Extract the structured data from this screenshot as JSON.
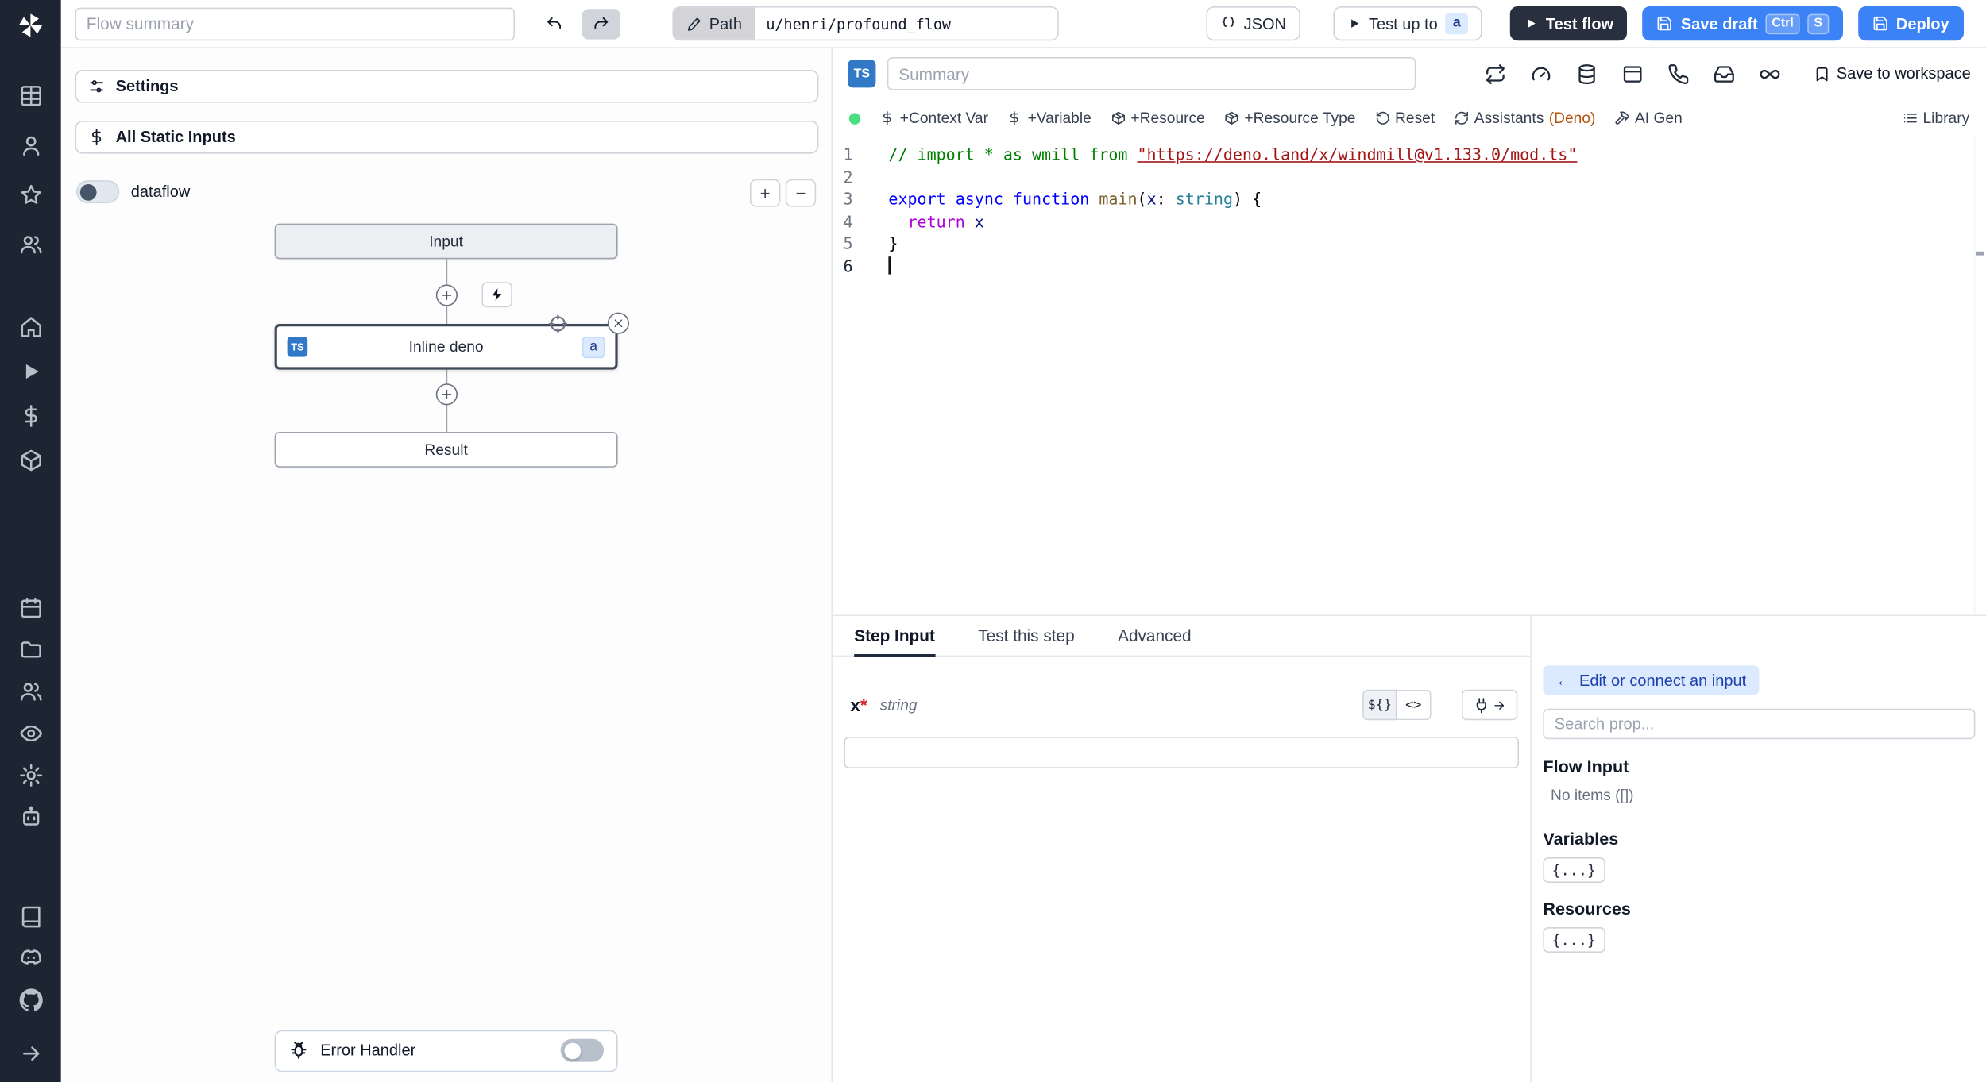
{
  "topbar": {
    "flow_summary_placeholder": "Flow summary",
    "path_label": "Path",
    "path_value": "u/henri/profound_flow",
    "json_label": "JSON",
    "test_up_to_label": "Test up to",
    "test_up_to_badge": "a",
    "test_flow_label": "Test flow",
    "save_draft_label": "Save draft",
    "kbd_ctrl": "Ctrl",
    "kbd_s": "S",
    "deploy_label": "Deploy"
  },
  "rail": {
    "groups": [
      [
        "table",
        "user",
        "star",
        "users"
      ],
      [
        "home",
        "play",
        "dollar",
        "cube"
      ],
      [
        "calendar",
        "folder",
        "users2",
        "eye",
        "settings",
        "bot"
      ],
      [
        "book",
        "discord",
        "github"
      ]
    ]
  },
  "flow": {
    "settings_label": "Settings",
    "static_inputs_label": "All Static Inputs",
    "dataflow_label": "dataflow",
    "zoom_in": "+",
    "zoom_out": "−",
    "nodes": {
      "input_label": "Input",
      "step_label": "Inline deno",
      "step_lang_badge": "TS",
      "step_id_badge": "a",
      "result_label": "Result"
    },
    "error_handler_label": "Error Handler"
  },
  "editor": {
    "lang_badge": "TS",
    "summary_placeholder": "Summary",
    "save_to_workspace_label": "Save to workspace",
    "trigger_icons": [
      "repeat",
      "gauge",
      "database",
      "window",
      "phone",
      "inbox",
      "infinity"
    ],
    "toolbar": {
      "context_var": "+Context Var",
      "variable": "+Variable",
      "resource": "+Resource",
      "resource_type": "+Resource Type",
      "reset": "Reset",
      "assistants": "Assistants",
      "assistants_lang": "(Deno)",
      "ai_gen": "AI Gen",
      "library": "Library"
    },
    "code": {
      "lines": [
        {
          "num": "1",
          "tokens": [
            [
              "// import * as wmill from ",
              "cmt"
            ],
            [
              "\"https://deno.land/x/windmill@v1.133.0/mod.ts\"",
              "lnk"
            ]
          ]
        },
        {
          "num": "2",
          "tokens": []
        },
        {
          "num": "3",
          "tokens": [
            [
              "export",
              "kw"
            ],
            [
              " ",
              ""
            ],
            [
              "async",
              "kw"
            ],
            [
              " ",
              ""
            ],
            [
              "function",
              "kw"
            ],
            [
              " ",
              ""
            ],
            [
              "main",
              "fn"
            ],
            [
              "(",
              ""
            ],
            [
              "x",
              "vr"
            ],
            [
              ": ",
              ""
            ],
            [
              "string",
              "ty"
            ],
            [
              ") {",
              ""
            ]
          ]
        },
        {
          "num": "4",
          "tokens": [
            [
              "  ",
              ""
            ],
            [
              "return",
              "kw2"
            ],
            [
              " ",
              ""
            ],
            [
              "x",
              "vr"
            ]
          ]
        },
        {
          "num": "5",
          "tokens": [
            [
              "}",
              ""
            ]
          ]
        },
        {
          "num": "6",
          "tokens": [],
          "cursor": true
        }
      ]
    }
  },
  "step_panel": {
    "tabs": [
      "Step Input",
      "Test this step",
      "Advanced"
    ],
    "arg_name": "x",
    "arg_required": "*",
    "arg_type": "string",
    "template_button": "${}",
    "code_button": "<>",
    "sidebar": {
      "connect_arrow": "←",
      "connect_label": "Edit or connect an input",
      "search_placeholder": "Search prop...",
      "flow_input_title": "Flow Input",
      "no_items": "No items ([])",
      "variables_title": "Variables",
      "resources_title": "Resources",
      "braces": "{...}"
    }
  }
}
